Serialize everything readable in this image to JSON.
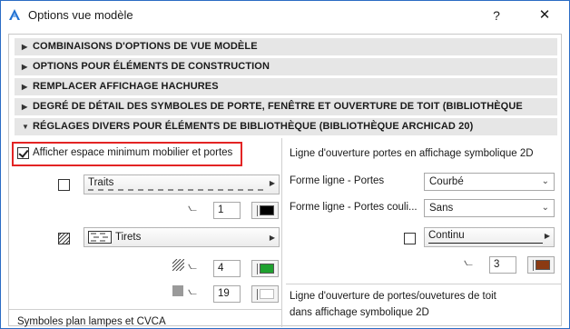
{
  "window": {
    "title": "Options vue modèle",
    "help_label": "?",
    "close_label": "✕"
  },
  "sections": [
    {
      "label": "COMBINAISONS D'OPTIONS DE VUE MODÈLE",
      "arrow": "▶"
    },
    {
      "label": "OPTIONS POUR ÉLÉMENTS DE CONSTRUCTION",
      "arrow": "▶"
    },
    {
      "label": "REMPLACER AFFICHAGE HACHURES",
      "arrow": "▶"
    },
    {
      "label": "DEGRÉ DE DÉTAIL DES SYMBOLES DE PORTE, FENÊTRE ET OUVERTURE DE TOIT (BIBLIOTHÈQUE ARCHICAD 20)",
      "arrow": "▶"
    },
    {
      "label": "RÉGLAGES DIVERS POUR ÉLÉMENTS DE BIBLIOTHÈQUE (BIBLIOTHÈQUE ARCHICAD 20)",
      "arrow": "▼"
    }
  ],
  "left": {
    "show_space_label": "Afficher espace minimum mobilier et portes",
    "show_space_checked": true,
    "line_type_label": "Traits",
    "line_pen": "1",
    "line_pen_color": "#000000",
    "fill_type_label": "Tirets",
    "fill_pen": "4",
    "fill_pen_color": "#1fa12f",
    "bg_pen": "19",
    "bg_pen_color": "#ffffff",
    "lamp_symbols_label": "Symboles plan lampes et CVCA"
  },
  "right": {
    "door_line_heading": "Ligne d'ouverture portes en affichage symbolique 2D",
    "door_line_shape_label": "Forme ligne - Portes",
    "door_line_shape_value": "Courbé",
    "sliding_door_shape_label": "Forme ligne - Portes couli...",
    "sliding_door_shape_value": "Sans",
    "line_type_value": "Continu",
    "line_pen": "3",
    "line_pen_color": "#8b3a12",
    "roof_heading_line1": "Ligne d'ouverture de portes/ouvetures de toit",
    "roof_heading_line2": "dans affichage symbolique 2D"
  }
}
